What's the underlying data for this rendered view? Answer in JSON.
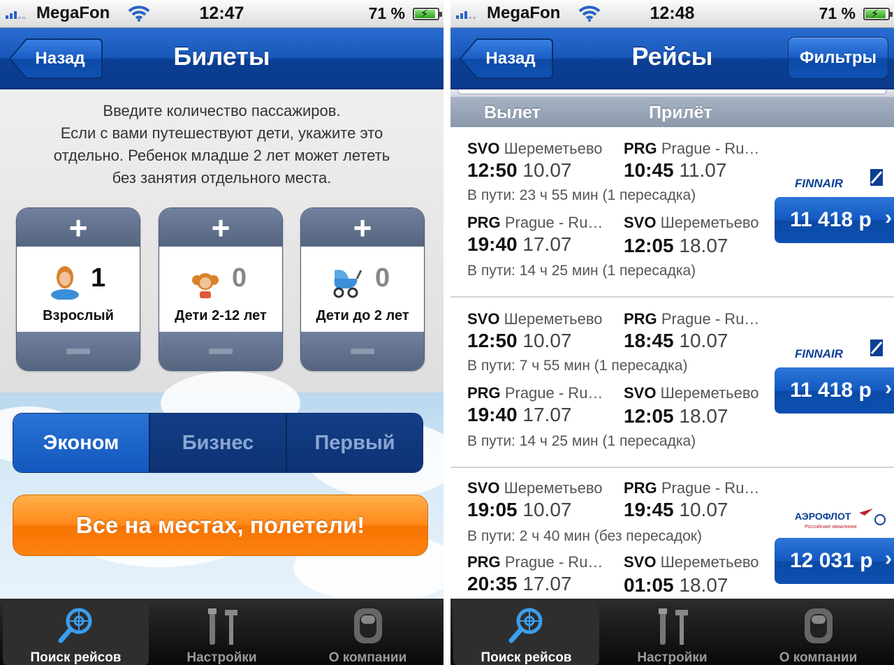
{
  "status": {
    "carrier": "MegaFon",
    "battery": "71 %",
    "time_left": "12:47",
    "time_right": "12:48"
  },
  "screen1": {
    "back": "Назад",
    "title": "Билеты",
    "intro": [
      "Введите количество пассажиров.",
      "Если с вами путешествуют дети, укажите это",
      "отдельно. Ребенок младше 2 лет может лететь",
      "без занятия отдельного места."
    ],
    "passengers": [
      {
        "label": "Взрослый",
        "count": "1",
        "icon": "adult-icon"
      },
      {
        "label": "Дети 2-12 лет",
        "count": "0",
        "icon": "child-icon"
      },
      {
        "label": "Дети до 2 лет",
        "count": "0",
        "icon": "stroller-icon"
      }
    ],
    "classes": {
      "economy": "Эконом",
      "business": "Бизнес",
      "first": "Первый",
      "selected": "Эконом"
    },
    "go": "Все на местах, полетели!"
  },
  "screen2": {
    "back": "Назад",
    "title": "Рейсы",
    "filters": "Фильтры",
    "col_depart": "Вылет",
    "col_arrive": "Прилёт",
    "flights": [
      {
        "out": {
          "from_code": "SVO",
          "from_name": "Шереметьево",
          "to_code": "PRG",
          "to_name": "Prague - Ru…",
          "dep_time": "12:50",
          "dep_date": "10.07",
          "arr_time": "10:45",
          "arr_date": "11.07",
          "duration": "В пути: 23 ч 55 мин (1 пересадка)"
        },
        "ret": {
          "from_code": "PRG",
          "from_name": "Prague - Ru…",
          "to_code": "SVO",
          "to_name": "Шереметьево",
          "dep_time": "19:40",
          "dep_date": "17.07",
          "arr_time": "12:05",
          "arr_date": "18.07",
          "duration": "В пути: 14 ч 25 мин (1 пересадка)"
        },
        "airline": "FINNAIR",
        "price": "11 418 р"
      },
      {
        "out": {
          "from_code": "SVO",
          "from_name": "Шереметьево",
          "to_code": "PRG",
          "to_name": "Prague - Ru…",
          "dep_time": "12:50",
          "dep_date": "10.07",
          "arr_time": "18:45",
          "arr_date": "10.07",
          "duration": "В пути: 7 ч 55 мин (1 пересадка)"
        },
        "ret": {
          "from_code": "PRG",
          "from_name": "Prague - Ru…",
          "to_code": "SVO",
          "to_name": "Шереметьево",
          "dep_time": "19:40",
          "dep_date": "17.07",
          "arr_time": "12:05",
          "arr_date": "18.07",
          "duration": "В пути: 14 ч 25 мин (1 пересадка)"
        },
        "airline": "FINNAIR",
        "price": "11 418 р"
      },
      {
        "out": {
          "from_code": "SVO",
          "from_name": "Шереметьево",
          "to_code": "PRG",
          "to_name": "Prague - Ru…",
          "dep_time": "19:05",
          "dep_date": "10.07",
          "arr_time": "19:45",
          "arr_date": "10.07",
          "duration": "В пути: 2 ч 40 мин (без пересадок)"
        },
        "ret": {
          "from_code": "PRG",
          "from_name": "Prague - Ru…",
          "to_code": "SVO",
          "to_name": "Шереметьево",
          "dep_time": "20:35",
          "dep_date": "17.07",
          "arr_time": "01:05",
          "arr_date": "18.07",
          "duration": ""
        },
        "airline": "АЭРОФЛОТ",
        "airline_sub": "Российские авиалинии",
        "price": "12 031 р"
      }
    ]
  },
  "tabs": [
    "Поиск рейсов",
    "Настройки",
    "О компании"
  ]
}
